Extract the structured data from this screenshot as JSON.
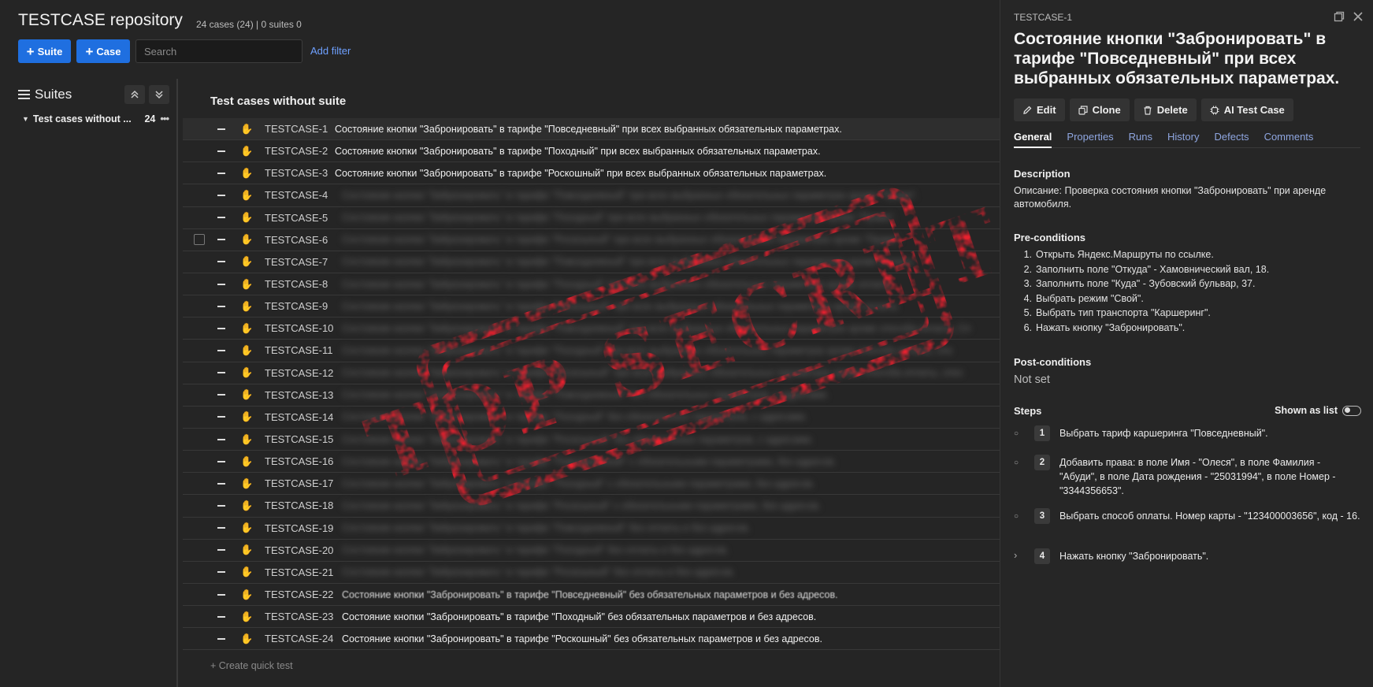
{
  "header": {
    "title": "TESTCASE repository",
    "counts": "24 cases (24) | 0 suites 0",
    "suite_button": "Suite",
    "case_button": "Case",
    "search_placeholder": "Search",
    "add_filter": "Add filter"
  },
  "sidebar": {
    "heading": "Suites",
    "suite_name": "Test cases without ...",
    "suite_count": "24",
    "more": "•••"
  },
  "list": {
    "title": "Test cases without suite",
    "quick_create": "+ Create quick test",
    "rows": [
      {
        "id": "TESTCASE-1",
        "title": "Состояние кнопки \"Забронировать\" в тарифе \"Повседневный\" при всех выбранных обязательных параметрах."
      },
      {
        "id": "TESTCASE-2",
        "title": "Состояние кнопки \"Забронировать\" в тарифе \"Походный\" при всех выбранных обязательных параметрах."
      },
      {
        "id": "TESTCASE-3",
        "title": "Состояние кнопки \"Забронировать\" в тарифе \"Роскошный\" при всех выбранных обязательных параметрах."
      },
      {
        "id": "TESTCASE-4",
        "title": "Состояние кнопки \"Забронировать\" в тарифе \"Повседневный\" при всех выбранных обязательных параметрах кроме \"Права\"."
      },
      {
        "id": "TESTCASE-5",
        "title": "Состояние кнопки \"Забронировать\" в тарифе \"Походный\" при всех выбранных обязательных параметрах кроме \"Права\"."
      },
      {
        "id": "TESTCASE-6",
        "title": "Состояние кнопки \"Забронировать\" в тарифе \"Роскошный\" при всех выбранных обязательных параметрах кроме \"Права\"."
      },
      {
        "id": "TESTCASE-7",
        "title": "Состояние кнопки \"Забронировать\" в тарифе \"Повседневный\" при всех выбранных обязательных параметрах кроме оплаты."
      },
      {
        "id": "TESTCASE-8",
        "title": "Состояние кнопки \"Забронировать\" в тарифе \"Походный\" при всех выбранных обязательных параметрах кроме оплаты."
      },
      {
        "id": "TESTCASE-9",
        "title": "Состояние кнопки \"Забронировать\" в тарифе \"Роскошный\" при всех выбранных обязательных параметрах кроме оплаты."
      },
      {
        "id": "TESTCASE-10",
        "title": "Состояние кнопки \"Забронировать\" в тарифе \"Повседневный\" при всех выбранных обязательных параметрах кроме способа оплаты, Сп"
      },
      {
        "id": "TESTCASE-11",
        "title": "Состояние кнопки \"Забронировать\" в тарифе \"Походный\" при всех выбранных обязательных параметрах кроме способа оплаты, спо"
      },
      {
        "id": "TESTCASE-12",
        "title": "Состояние кнопки \"Забронировать\" в тарифе \"Роскошный\" при всех выбранных обязательных параметрах кроме способа оплаты, спос"
      },
      {
        "id": "TESTCASE-13",
        "title": "Состояние кнопки \"Забронировать\" в тарифе \"Повседневный\" без обязательных параметров, с адресами."
      },
      {
        "id": "TESTCASE-14",
        "title": "Состояние кнопки \"Забронировать\" в тарифе \"Походный\" без обязательных параметров, с адресами."
      },
      {
        "id": "TESTCASE-15",
        "title": "Состояние кнопки \"Забронировать\" в тарифе \"Роскошный\" без обязательных параметров, с адресами."
      },
      {
        "id": "TESTCASE-16",
        "title": "Состояние кнопки \"Забронировать\" в тарифе \"Повседневный\" с обязательными параметрами, без адресов."
      },
      {
        "id": "TESTCASE-17",
        "title": "Состояние кнопки \"Забронировать\" в тарифе \"Походный\" с обязательными параметрами, без адресов."
      },
      {
        "id": "TESTCASE-18",
        "title": "Состояние кнопки \"Забронировать\" в тарифе \"Роскошный\" с обязательными параметрами, без адресов."
      },
      {
        "id": "TESTCASE-19",
        "title": "Состояние кнопки \"Забронировать\" в тарифе \"Повседневный\" без оплаты и без адресов."
      },
      {
        "id": "TESTCASE-20",
        "title": "Состояние кнопки \"Забронировать\" в тарифе \"Походный\" без оплаты и без адресов."
      },
      {
        "id": "TESTCASE-21",
        "title": "Состояние кнопки \"Забронировать\" в тарифе \"Роскошный\" без оплаты и без адресов."
      },
      {
        "id": "TESTCASE-22",
        "title": "Состояние кнопки \"Забронировать\" в тарифе \"Повседневный\" без обязательных параметров и без адресов."
      },
      {
        "id": "TESTCASE-23",
        "title": "Состояние кнопки \"Забронировать\" в тарифе \"Походный\" без обязательных параметров и без адресов."
      },
      {
        "id": "TESTCASE-24",
        "title": "Состояние кнопки \"Забронировать\" в тарифе \"Роскошный\" без обязательных параметров и без адресов."
      }
    ]
  },
  "stamp": {
    "text": "TOP SECRET",
    "color": "#e8202e"
  },
  "detail": {
    "id": "TESTCASE-1",
    "title": "Состояние кнопки \"Забронировать\" в тарифе \"Повседневный\" при всех выбранных обязательных параметрах.",
    "actions": {
      "edit": "Edit",
      "clone": "Clone",
      "delete": "Delete",
      "ai": "AI Test Case"
    },
    "tabs": [
      "General",
      "Properties",
      "Runs",
      "History",
      "Defects",
      "Comments"
    ],
    "description_heading": "Description",
    "description": "Описание: Проверка состояния кнопки \"Забронировать\" при аренде автомобиля.",
    "preconditions_heading": "Pre-conditions",
    "preconditions": [
      "Открыть Яндекс.Маршруты по ссылке.",
      "Заполнить поле \"Откуда\" - Хамовнический вал, 18.",
      "Заполнить поле \"Куда\" - Зубовский бульвар, 37.",
      "Выбрать режим \"Свой\".",
      "Выбрать тип транспорта \"Каршеринг\".",
      "Нажать кнопку \"Забронировать\"."
    ],
    "postconditions_heading": "Post-conditions",
    "postconditions": "Not set",
    "steps_heading": "Steps",
    "shown_as_list": "Shown as list",
    "steps": [
      {
        "n": "1",
        "text": "Выбрать тариф каршеринга \"Повседневный\"."
      },
      {
        "n": "2",
        "text": "Добавить права: в поле Имя - \"Олеся\", в поле Фамилия - \"Абуди\", в поле Дата рождения - \"25031994\", в поле Номер - \"3344356653\"."
      },
      {
        "n": "3",
        "text": "Выбрать способ оплаты. Номер карты - \"123400003656\", код - 16."
      },
      {
        "n": "4",
        "text": "Нажать кнопку \"Забронировать\"."
      }
    ]
  }
}
